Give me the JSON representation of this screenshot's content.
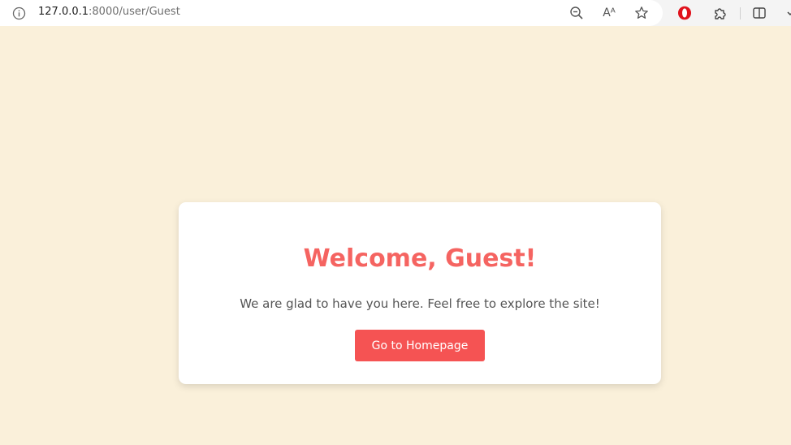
{
  "browser": {
    "url_host": "127.0.0.1",
    "url_rest": ":8000/user/Guest",
    "icons": [
      "info-icon",
      "zoom-out-icon",
      "read-aloud-icon",
      "favorite-star-icon",
      "opera-icon",
      "extensions-icon",
      "split-screen-icon",
      "chevron-down-icon"
    ],
    "read_aloud_glyph": "Aᴬ"
  },
  "card": {
    "title": "Welcome, Guest!",
    "subtitle": "We are glad to have you here. Feel free to explore the site!",
    "button_label": "Go to Homepage"
  },
  "colors": {
    "page_background": "#faf0da",
    "title": "#f56461",
    "button": "#f55353",
    "text": "#555555"
  }
}
